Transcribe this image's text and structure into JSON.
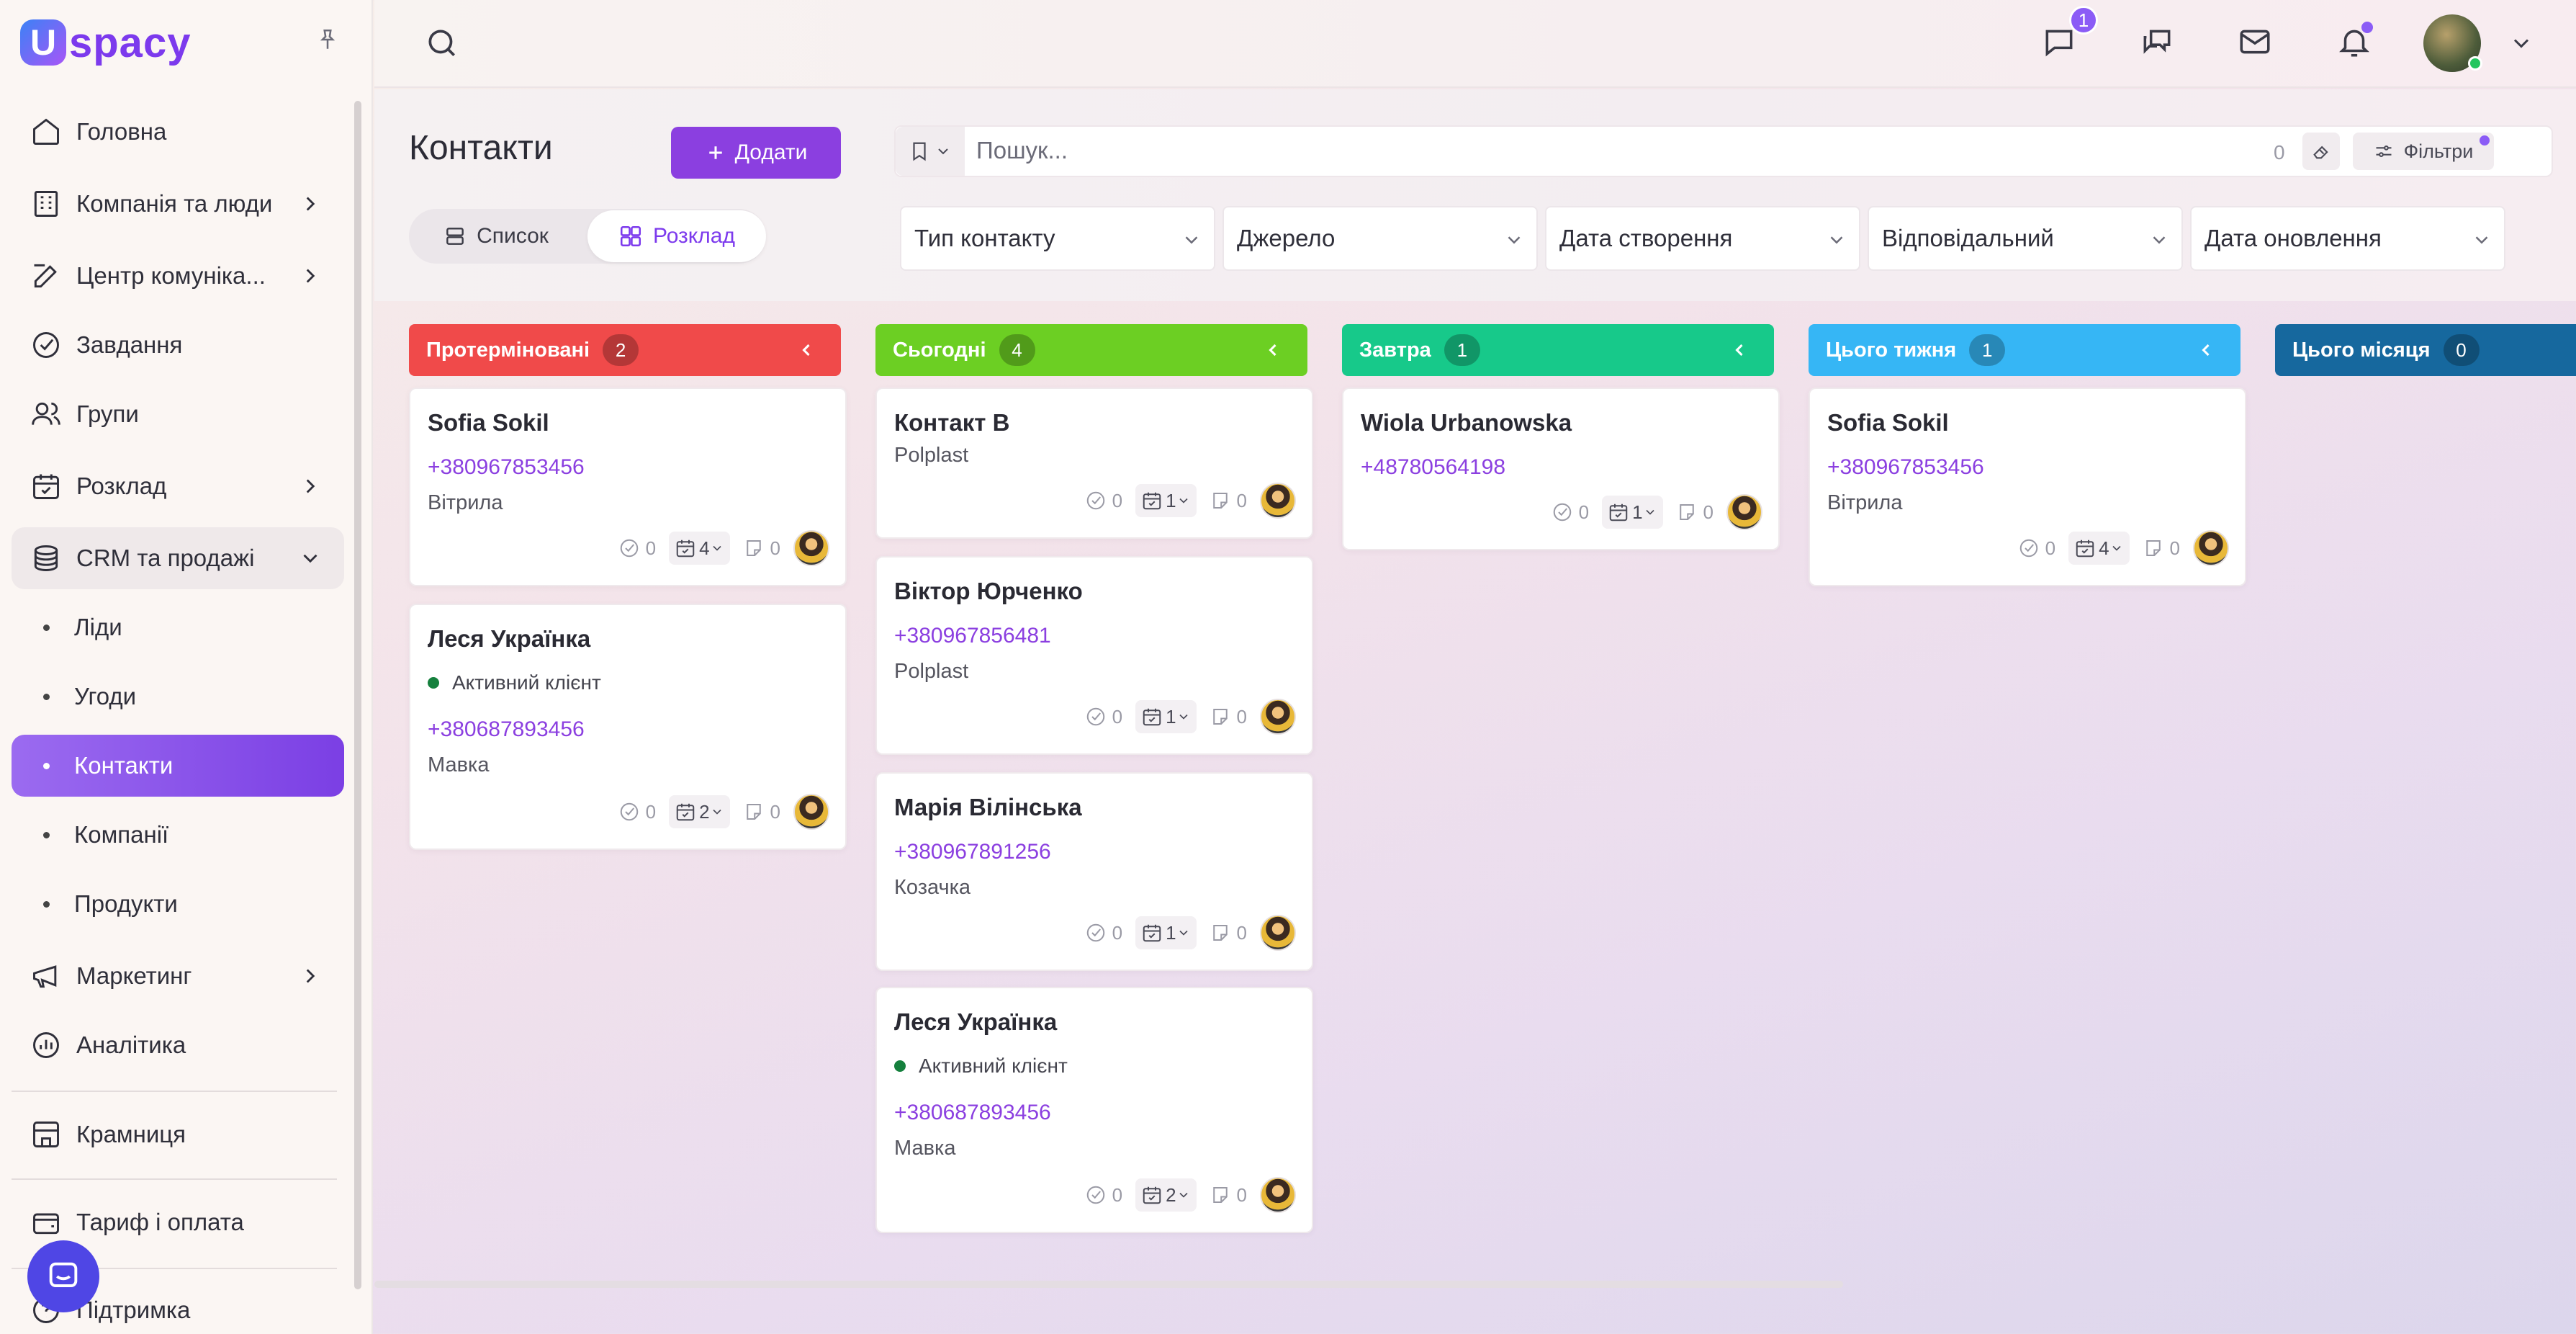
{
  "brand": {
    "logo_letter": "U",
    "logo_text": "spacy"
  },
  "sidebar": {
    "items": [
      {
        "label": "Головна",
        "icon": "home-icon"
      },
      {
        "label": "Компанія та люди",
        "icon": "building-icon",
        "expandable": true
      },
      {
        "label": "Центр комуніка...",
        "icon": "edit-icon",
        "expandable": true
      },
      {
        "label": "Завдання",
        "icon": "check-circle-icon"
      },
      {
        "label": "Групи",
        "icon": "users-icon"
      },
      {
        "label": "Розклад",
        "icon": "calendar-icon",
        "expandable": true
      },
      {
        "label": "CRM та продажі",
        "icon": "layers-icon",
        "expanded": true
      }
    ],
    "crm_sub": [
      "Ліди",
      "Угоди",
      "Контакти",
      "Компанії",
      "Продукти"
    ],
    "active_sub": "Контакти",
    "items_bottom": [
      {
        "label": "Маркетинг",
        "icon": "megaphone-icon",
        "expandable": true
      },
      {
        "label": "Аналітика",
        "icon": "chart-icon"
      },
      {
        "label": "Крамниця",
        "icon": "store-icon"
      },
      {
        "label": "Тариф і оплата",
        "icon": "wallet-icon"
      },
      {
        "label": "Підтримка",
        "icon": "support-icon"
      }
    ]
  },
  "topbar": {
    "messages_badge": "1"
  },
  "page": {
    "title": "Контакти",
    "add_label": "Додати",
    "view_list": "Список",
    "view_schedule": "Розклад",
    "search_placeholder": "Пошук...",
    "search_count": "0",
    "filters_label": "Фільтри",
    "filters": [
      "Тип контакту",
      "Джерело",
      "Дата створення",
      "Відповідальний",
      "Дата оновлення"
    ]
  },
  "board": {
    "columns": [
      {
        "title": "Протерміновані",
        "count": "2",
        "color": "#f04a4a"
      },
      {
        "title": "Сьогодні",
        "count": "4",
        "color": "#6ccf23"
      },
      {
        "title": "Завтра",
        "count": "1",
        "color": "#17c98a"
      },
      {
        "title": "Цього тижня",
        "count": "1",
        "color": "#36b6f5"
      },
      {
        "title": "Цього місяця",
        "count": "0",
        "color": "#16689e"
      }
    ],
    "cards": {
      "c1a": {
        "name": "Sofia Sokil",
        "phone": "+380967853456",
        "company": "Вітрила",
        "tasks": "0",
        "events": "4",
        "notes": "0"
      },
      "c1b": {
        "name": "Леся Українка",
        "status": "Активний клієнт",
        "phone": "+380687893456",
        "company": "Мавка",
        "tasks": "0",
        "events": "2",
        "notes": "0"
      },
      "c2a": {
        "name": "Контакт B",
        "company": "Polplast",
        "tasks": "0",
        "events": "1",
        "notes": "0"
      },
      "c2b": {
        "name": "Віктор Юрченко",
        "phone": "+380967856481",
        "company": "Polplast",
        "tasks": "0",
        "events": "1",
        "notes": "0"
      },
      "c2c": {
        "name": "Марія Вілінська",
        "phone": "+380967891256",
        "company": "Козачка",
        "tasks": "0",
        "events": "1",
        "notes": "0"
      },
      "c2d": {
        "name": "Леся Українка",
        "status": "Активний клієнт",
        "phone": "+380687893456",
        "company": "Мавка",
        "tasks": "0",
        "events": "2",
        "notes": "0"
      },
      "c3a": {
        "name": "Wiola Urbanowska",
        "phone": "+48780564198",
        "tasks": "0",
        "events": "1",
        "notes": "0"
      },
      "c4a": {
        "name": "Sofia Sokil",
        "phone": "+380967853456",
        "company": "Вітрила",
        "tasks": "0",
        "events": "4",
        "notes": "0"
      }
    }
  }
}
